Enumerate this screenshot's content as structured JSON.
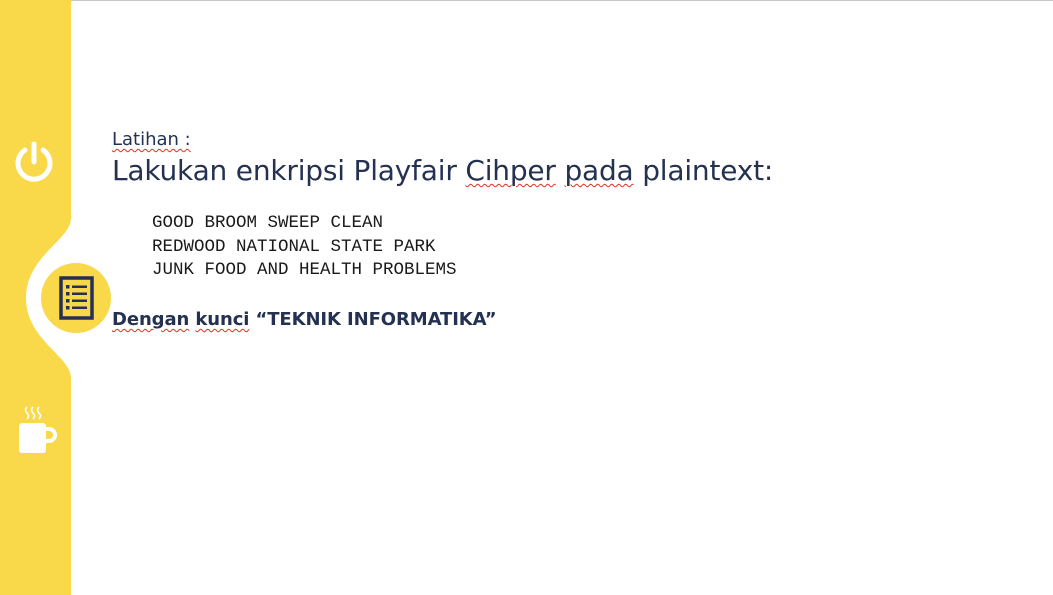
{
  "slide": {
    "label": "Latihan :",
    "title_words": [
      "Lakukan",
      "enkripsi",
      "Playfair",
      "Cihper",
      "pada",
      "plaintext:"
    ],
    "plaintexts": [
      "GOOD BROOM SWEEP CLEAN",
      "REDWOOD NATIONAL STATE PARK",
      "JUNK FOOD AND HEALTH PROBLEMS"
    ],
    "key_prefix": [
      "Dengan",
      "kunci"
    ],
    "key_value": "“TEKNIK INFORMATIKA”"
  },
  "sidebar": {
    "accent_color": "#f9d849",
    "icon_color": "#ffffff",
    "active_icon_color": "#243150",
    "icons": [
      "power-icon",
      "document-list-icon",
      "coffee-mug-icon"
    ]
  },
  "colors": {
    "text_dark": "#243150",
    "spellcheck": "#e0301e"
  }
}
